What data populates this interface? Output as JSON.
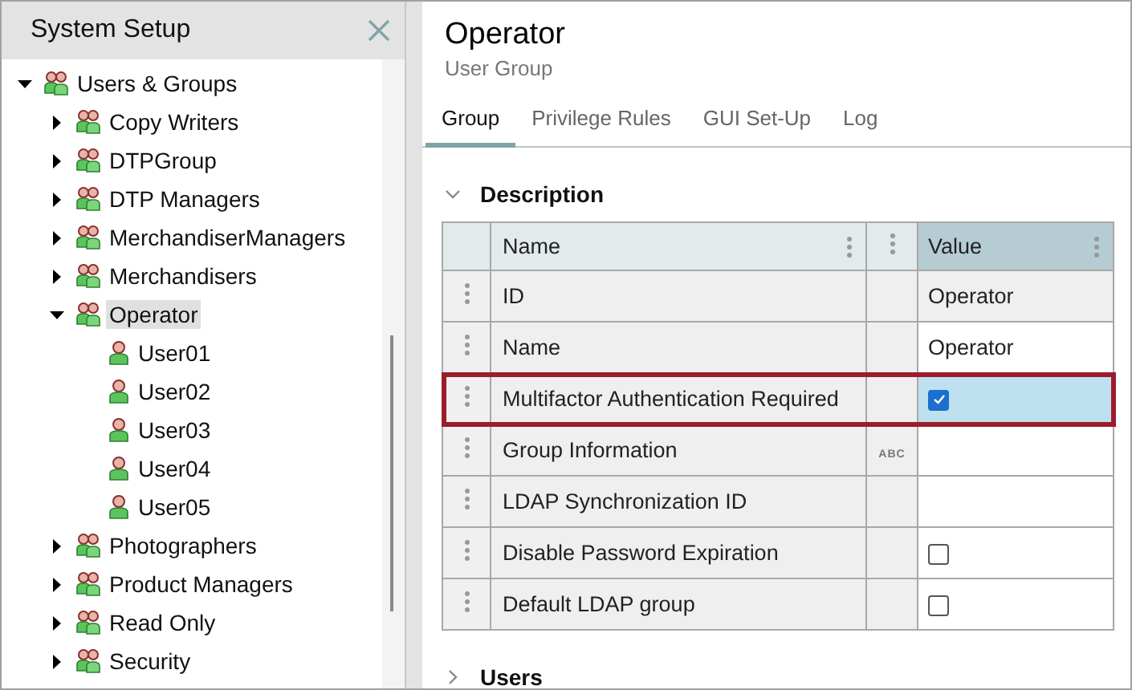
{
  "sidebar": {
    "title": "System Setup",
    "tree": [
      {
        "label": "Users & Groups",
        "kind": "group",
        "expanded": true,
        "selected": false,
        "children": [
          {
            "label": "Copy Writers",
            "kind": "group",
            "expanded": false,
            "selected": false
          },
          {
            "label": "DTPGroup",
            "kind": "group",
            "expanded": false,
            "selected": false
          },
          {
            "label": "DTP Managers",
            "kind": "group",
            "expanded": false,
            "selected": false
          },
          {
            "label": "MerchandiserManagers",
            "kind": "group",
            "expanded": false,
            "selected": false
          },
          {
            "label": "Merchandisers",
            "kind": "group",
            "expanded": false,
            "selected": false
          },
          {
            "label": "Operator",
            "kind": "group",
            "expanded": true,
            "selected": true,
            "children": [
              {
                "label": "User01",
                "kind": "user",
                "selected": false
              },
              {
                "label": "User02",
                "kind": "user",
                "selected": false
              },
              {
                "label": "User03",
                "kind": "user",
                "selected": false
              },
              {
                "label": "User04",
                "kind": "user",
                "selected": false
              },
              {
                "label": "User05",
                "kind": "user",
                "selected": false
              }
            ]
          },
          {
            "label": "Photographers",
            "kind": "group",
            "expanded": false,
            "selected": false
          },
          {
            "label": "Product Managers",
            "kind": "group",
            "expanded": false,
            "selected": false
          },
          {
            "label": "Read Only",
            "kind": "group",
            "expanded": false,
            "selected": false
          },
          {
            "label": "Security",
            "kind": "group",
            "expanded": false,
            "selected": false
          }
        ]
      }
    ]
  },
  "detail": {
    "title": "Operator",
    "subtitle": "User Group",
    "tabs": [
      {
        "label": "Group",
        "selected": true
      },
      {
        "label": "Privilege Rules",
        "selected": false
      },
      {
        "label": "GUI Set-Up",
        "selected": false
      },
      {
        "label": "Log",
        "selected": false
      }
    ],
    "sections": [
      {
        "title": "Description",
        "expanded": true,
        "table": {
          "columns": [
            "Name",
            "Value"
          ],
          "rows": [
            {
              "name": "ID",
              "kind": "text",
              "value": "Operator",
              "editable": false,
              "selected": false
            },
            {
              "name": "Name",
              "kind": "text",
              "value": "Operator",
              "editable": true,
              "selected": false
            },
            {
              "name": "Multifactor Authentication Required",
              "kind": "checkbox",
              "checked": true,
              "editable": true,
              "selected": true
            },
            {
              "name": "Group Information",
              "kind": "text",
              "type_label": "ABC",
              "editable": true,
              "selected": false
            },
            {
              "name": "LDAP Synchronization ID",
              "kind": "text",
              "editable": true,
              "selected": false
            },
            {
              "name": "Disable Password Expiration",
              "kind": "checkbox",
              "checked": false,
              "editable": true,
              "selected": false
            },
            {
              "name": "Default LDAP group",
              "kind": "checkbox",
              "checked": false,
              "editable": true,
              "selected": false
            }
          ]
        }
      },
      {
        "title": "Users",
        "expanded": false
      }
    ]
  }
}
